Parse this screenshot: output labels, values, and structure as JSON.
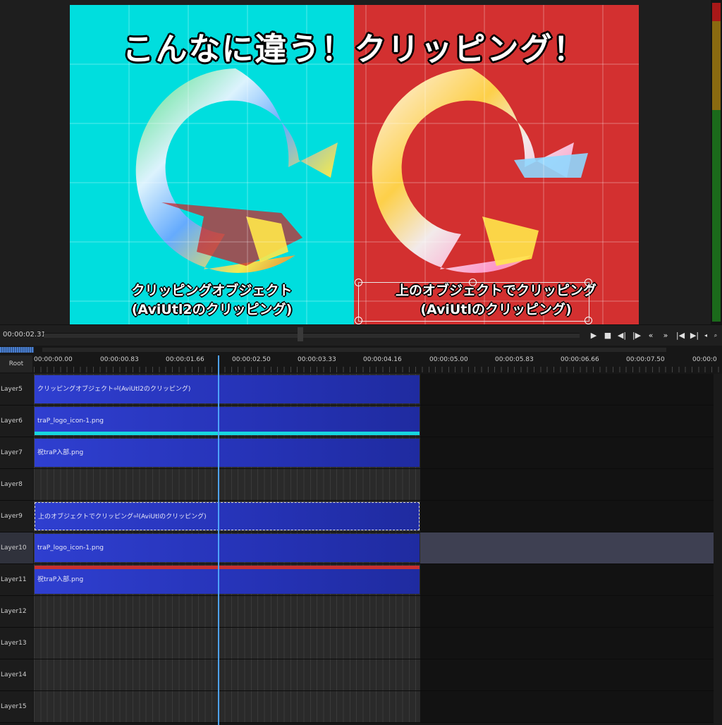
{
  "preview": {
    "title": "こんなに違う！クリッピング！",
    "caption_left": [
      "クリッピングオブジェクト",
      "(AviUtl2のクリッピング)"
    ],
    "caption_right": [
      "上のオブジェクトでクリッピング",
      "(AviUtlのクリッピング)"
    ],
    "left_bg_color": "#00dede",
    "right_bg_color": "#d33030"
  },
  "transport": {
    "current_time": "00:00:02.31",
    "buttons": [
      "play-icon",
      "stop-icon",
      "prev-frame-icon",
      "next-frame-icon",
      "rewind-icon",
      "fast-forward-icon",
      "go-start-icon",
      "go-end-icon",
      "volume-icon",
      "zoom-icon"
    ]
  },
  "timeline": {
    "root_label": "Root",
    "ruler": [
      "00:00:00.00",
      "00:00:00.83",
      "00:00:01.66",
      "00:00:02.50",
      "00:00:03.33",
      "00:00:04.16",
      "00:00:05.00",
      "00:00:05.83",
      "00:00:06.66",
      "00:00:07.50",
      "00:00:0"
    ],
    "layers": [
      {
        "name": "Layer5",
        "clip": "クリッピングオブジェクト⏎(AviUtl2のクリッピング)"
      },
      {
        "name": "Layer6",
        "clip": "traP_logo_icon-1.png"
      },
      {
        "name": "Layer7",
        "clip": "祝traP入部.png"
      },
      {
        "name": "Layer8",
        "clip": ""
      },
      {
        "name": "Layer9",
        "clip": "上のオブジェクトでクリッピング⏎(AviUtlのクリッピング)"
      },
      {
        "name": "Layer10",
        "clip": "traP_logo_icon-1.png"
      },
      {
        "name": "Layer11",
        "clip": "祝traP入部.png"
      },
      {
        "name": "Layer12",
        "clip": ""
      },
      {
        "name": "Layer13",
        "clip": ""
      },
      {
        "name": "Layer14",
        "clip": ""
      },
      {
        "name": "Layer15",
        "clip": ""
      }
    ],
    "selected_layer": "Layer10",
    "playhead_time": "00:00:02.31"
  }
}
